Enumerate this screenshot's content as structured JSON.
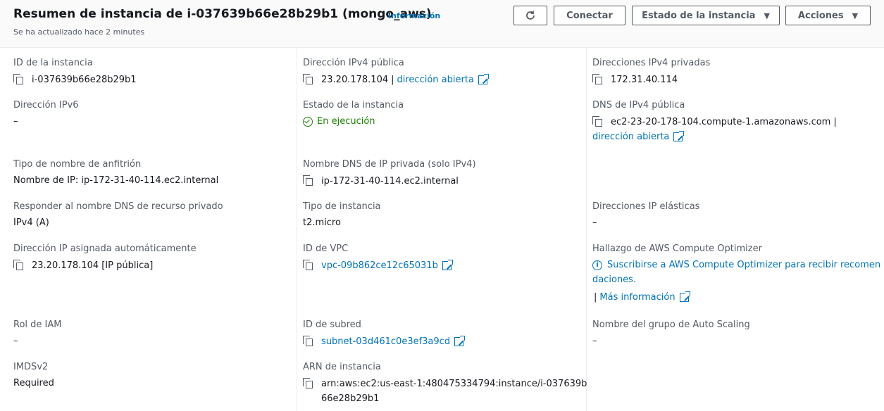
{
  "header": {
    "title": "Resumen de instancia de i-037639b66e28b29b1 (mongo_aws)",
    "info_link": "Información",
    "subtitle": "Se ha actualizado hace 2 minutes",
    "buttons": {
      "refresh_icon": "refresh-icon",
      "connect": "Conectar",
      "instance_state": "Estado de la instancia",
      "actions": "Acciones"
    }
  },
  "fields": {
    "instance_id": {
      "label": "ID de la instancia",
      "value": "i-037639b66e28b29b1"
    },
    "ipv6": {
      "label": "Dirección IPv6",
      "value": "–"
    },
    "hostname_type": {
      "label": "Tipo de nombre de anfitrión",
      "value": "Nombre de IP: ip-172-31-40-114.ec2.internal"
    },
    "private_dns_answer": {
      "label": "Responder al nombre DNS de recurso privado",
      "value": "IPv4 (A)"
    },
    "auto_ip": {
      "label": "Dirección IP asignada automáticamente",
      "value": "23.20.178.104 [IP pública]"
    },
    "iam_role": {
      "label": "Rol de IAM",
      "value": "–"
    },
    "imdsv2": {
      "label": "IMDSv2",
      "value": "Required"
    },
    "public_ipv4": {
      "label": "Dirección IPv4 pública",
      "value": "23.20.178.104",
      "separator": "|",
      "link": "dirección abierta"
    },
    "instance_state": {
      "label": "Estado de la instancia",
      "value": "En ejecución"
    },
    "private_dns_name": {
      "label": "Nombre DNS de IP privada (solo IPv4)",
      "value": "ip-172-31-40-114.ec2.internal"
    },
    "instance_type": {
      "label": "Tipo de instancia",
      "value": "t2.micro"
    },
    "vpc_id": {
      "label": "ID de VPC",
      "value": "vpc-09b862ce12c65031b"
    },
    "subnet_id": {
      "label": "ID de subred",
      "value": "subnet-03d461c0e3ef3a9cd"
    },
    "instance_arn": {
      "label": "ARN de instancia",
      "value_line1": "arn:aws:ec2:us-east-1:480475334794:instance/i-037639b",
      "value_line2": "66e28b29b1"
    },
    "private_ipv4": {
      "label": "Direcciones IPv4 privadas",
      "value": "172.31.40.114"
    },
    "public_dns": {
      "label": "DNS de IPv4 pública",
      "value": "ec2-23-20-178-104.compute-1.amazonaws.com",
      "separator": "|",
      "link": "dirección abierta"
    },
    "elastic_ip": {
      "label": "Direcciones IP elásticas",
      "value": "–"
    },
    "compute_optimizer": {
      "label": "Hallazgo de AWS Compute Optimizer",
      "link_line1": "Suscribirse a AWS Compute Optimizer para recibir recomen",
      "link_line2": "daciones.",
      "separator": "|",
      "more_link": "Más información"
    },
    "asg_name": {
      "label": "Nombre del grupo de Auto Scaling",
      "value": "–"
    }
  },
  "colors": {
    "link": "#0073bb",
    "running": "#1d8102",
    "label": "#545b64",
    "text": "#16191f"
  }
}
